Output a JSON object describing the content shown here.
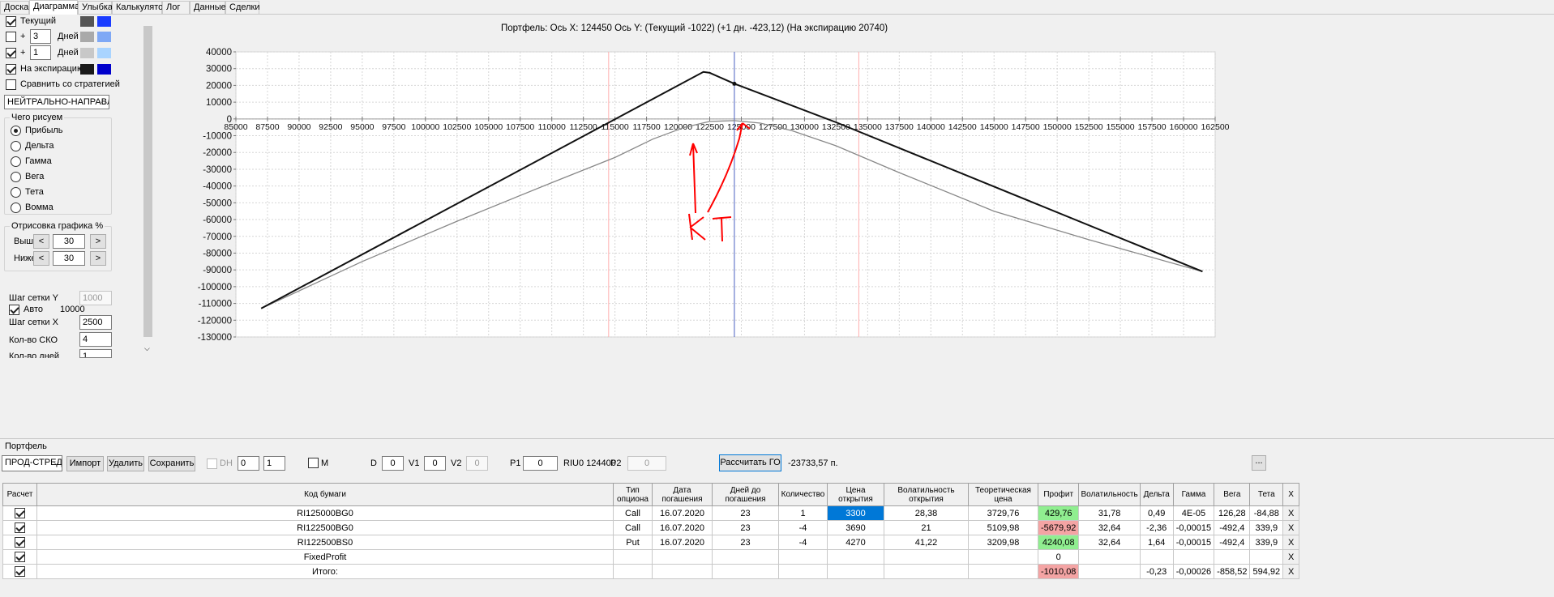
{
  "tabs": [
    "Доска",
    "Диаграмма",
    "Улыбка",
    "Калькулятор",
    "Лог",
    "Данные",
    "Сделки"
  ],
  "active_tab": "Диаграмма",
  "left": {
    "current_label": "Текущий",
    "plus": "+",
    "days1_value": "3",
    "days2_value": "1",
    "days_label": "Дней",
    "expiry_label": "На экспирацию",
    "compare_label": "Сравнить со стратегией",
    "strategy_value": "НЕЙТРАЛЬНО-НАПРАВЛЕ",
    "draw_group": "Чего рисуем",
    "radios": [
      "Прибыль",
      "Дельта",
      "Гамма",
      "Вега",
      "Тета",
      "Вомма"
    ],
    "plot_group": "Отрисовка графика %",
    "above_label": "Выше",
    "below_label": "Ниже",
    "above_value": "30",
    "below_value": "30",
    "less": "<",
    "more": ">",
    "grid_y_label": "Шаг сетки Y",
    "grid_y_value": "1000",
    "auto_label": "Авто",
    "auto_value": "10000",
    "grid_x_label": "Шаг сетки X",
    "grid_x_value": "2500",
    "sko_label": "Кол-во СКО",
    "sko_value": "4",
    "days_count_label": "Кол-во дней",
    "days_count_value": "1",
    "colors": {
      "current": [
        "#555555",
        "#1a3cff"
      ],
      "d3": [
        "#a9a9a9",
        "#7fa8f5"
      ],
      "d1": [
        "#c8c8c8",
        "#a9d4ff"
      ],
      "exp": [
        "#1a1a1a",
        "#0000cc"
      ]
    }
  },
  "chart": {
    "title": "Портфель: Ось X: 124450 Ось Y:  (Текущий -1022)  (+1 дн. -423,12)  (На экспирацию 20740)",
    "annotation_text": "КТ",
    "annotation_color": "#ff0000"
  },
  "chart_data": {
    "type": "line",
    "xlim": [
      85000,
      162500
    ],
    "ylim": [
      -130000,
      40000
    ],
    "x_ticks": [
      85000,
      87500,
      90000,
      92500,
      95000,
      97500,
      100000,
      102500,
      105000,
      107500,
      110000,
      112500,
      115000,
      117500,
      120000,
      122500,
      125000,
      127500,
      130000,
      132500,
      135000,
      137500,
      140000,
      142500,
      145000,
      147500,
      150000,
      152500,
      155000,
      157500,
      160000,
      162500
    ],
    "y_ticks": [
      40000,
      30000,
      20000,
      10000,
      0,
      -10000,
      -20000,
      -30000,
      -40000,
      -50000,
      -60000,
      -70000,
      -80000,
      -90000,
      -100000,
      -110000,
      -120000,
      -130000
    ],
    "grid": true,
    "vlines": [
      {
        "x": 114500,
        "color": "#ffb0b0"
      },
      {
        "x": 124450,
        "color": "#4a5fc1"
      },
      {
        "x": 134300,
        "color": "#ffb0b0"
      }
    ],
    "series": [
      {
        "color": "#111111",
        "points": [
          [
            87000,
            -113000
          ],
          [
            122000,
            28000
          ],
          [
            122500,
            27500
          ],
          [
            124450,
            21000
          ],
          [
            132500,
            -2000
          ],
          [
            161500,
            -91000
          ]
        ]
      },
      {
        "color": "#888888",
        "points": [
          [
            87000,
            -113000
          ],
          [
            95000,
            -85000
          ],
          [
            102500,
            -61000
          ],
          [
            110000,
            -38000
          ],
          [
            115000,
            -23000
          ],
          [
            118000,
            -12000
          ],
          [
            120500,
            -5000
          ],
          [
            122500,
            -1500
          ],
          [
            124450,
            -1022
          ],
          [
            126500,
            -2500
          ],
          [
            129000,
            -7000
          ],
          [
            132500,
            -16000
          ],
          [
            137500,
            -32000
          ],
          [
            145000,
            -55000
          ],
          [
            152500,
            -72000
          ],
          [
            161500,
            -91000
          ]
        ]
      }
    ],
    "marker": [
      124450,
      21000
    ]
  },
  "portfolio": {
    "label": "Портфель",
    "strategy_value": "ПРОД-СТРЕД",
    "import_label": "Импорт",
    "delete_label": "Удалить",
    "save_label": "Сохранить",
    "dh_label": "DH",
    "dh_v1": "0",
    "dh_v2": "1",
    "m_label": "M",
    "d_label": "D",
    "d_value": "0",
    "v1_label": "V1",
    "v1_value": "0",
    "v2_label": "V2",
    "v2_value": "0",
    "p1_label": "P1",
    "p1_value": "0",
    "riu_label": "RIU0 124400",
    "p2_label": "P2",
    "p2_value": "0",
    "calc_label": "Рассчитать ГО",
    "go_value": "-23733,57 п.",
    "dots_label": "..."
  },
  "table": {
    "headers": [
      "Расчет",
      "Код бумаги",
      "Тип опциона",
      "Дата погашения",
      "Дней до погашения",
      "Количество",
      "Цена открытия",
      "Волатильность открытия",
      "Теоретическая цена",
      "Профит",
      "Волатильность",
      "Дельта",
      "Гамма",
      "Вега",
      "Тета",
      "X"
    ],
    "rows": [
      {
        "code": "RI125000BG0",
        "type": "Call",
        "date": "16.07.2020",
        "days": "23",
        "qty": "1",
        "price": "3300",
        "vol_open": "28,38",
        "theo": "3729,76",
        "profit": "429,76",
        "vol": "31,78",
        "delta": "0,49",
        "gamma": "4E-05",
        "vega": "126,28",
        "theta": "-84,88",
        "x": "X"
      },
      {
        "code": "RI122500BG0",
        "type": "Call",
        "date": "16.07.2020",
        "days": "23",
        "qty": "-4",
        "price": "3690",
        "vol_open": "21",
        "theo": "5109,98",
        "profit": "-5679,92",
        "vol": "32,64",
        "delta": "-2,36",
        "gamma": "-0,00015",
        "vega": "-492,4",
        "theta": "339,9",
        "x": "X"
      },
      {
        "code": "RI122500BS0",
        "type": "Put",
        "date": "16.07.2020",
        "days": "23",
        "qty": "-4",
        "price": "4270",
        "vol_open": "41,22",
        "theo": "3209,98",
        "profit": "4240,08",
        "vol": "32,64",
        "delta": "1,64",
        "gamma": "-0,00015",
        "vega": "-492,4",
        "theta": "339,9",
        "x": "X"
      },
      {
        "code": "FixedProfit",
        "type": "",
        "date": "",
        "days": "",
        "qty": "",
        "price": "",
        "vol_open": "",
        "theo": "",
        "profit": "0",
        "vol": "",
        "delta": "",
        "gamma": "",
        "vega": "",
        "theta": "",
        "x": "X"
      },
      {
        "code": "Итого:",
        "type": "",
        "date": "",
        "days": "",
        "qty": "",
        "price": "",
        "vol_open": "",
        "theo": "",
        "profit": "-1010,08",
        "vol": "",
        "delta": "-0,23",
        "gamma": "-0,00026",
        "vega": "-858,52",
        "theta": "594,92",
        "x": "X"
      }
    ]
  }
}
